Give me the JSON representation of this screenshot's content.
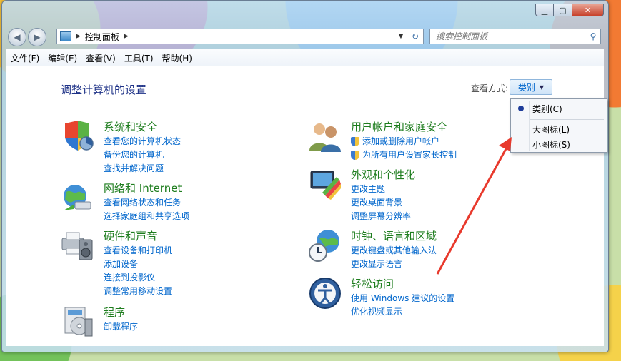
{
  "window": {
    "address_path": "控制面板",
    "search_placeholder": "搜索控制面板"
  },
  "menu": [
    "文件(F)",
    "编辑(E)",
    "查看(V)",
    "工具(T)",
    "帮助(H)"
  ],
  "main": {
    "title": "调整计算机的设置",
    "view_by_label": "查看方式:",
    "view_by_value": "类别"
  },
  "dropdown": {
    "items": [
      "类别(C)",
      "大图标(L)",
      "小图标(S)"
    ],
    "selected": "类别(C)"
  },
  "categories": [
    {
      "name": "系统和安全",
      "links": [
        "查看您的计算机状态",
        "备份您的计算机",
        "查找并解决问题"
      ]
    },
    {
      "name": "网络和 Internet",
      "links": [
        "查看网络状态和任务",
        "选择家庭组和共享选项"
      ]
    },
    {
      "name": "硬件和声音",
      "links": [
        "查看设备和打印机",
        "添加设备",
        "连接到投影仪",
        "调整常用移动设置"
      ]
    },
    {
      "name": "程序",
      "links": [
        "卸载程序"
      ]
    },
    {
      "name": "用户帐户和家庭安全",
      "links": [
        "添加或删除用户帐户",
        "为所有用户设置家长控制"
      ]
    },
    {
      "name": "外观和个性化",
      "links": [
        "更改主题",
        "更改桌面背景",
        "调整屏幕分辨率"
      ]
    },
    {
      "name": "时钟、语言和区域",
      "links": [
        "更改键盘或其他输入法",
        "更改显示语言"
      ]
    },
    {
      "name": "轻松访问",
      "links": [
        "使用 Windows 建议的设置",
        "优化视频显示"
      ]
    }
  ],
  "colors": {
    "heading_green": "#1e7d1e",
    "link_blue": "#0066cc",
    "title_blue": "#1e3287",
    "annotation_red": "#e8392c"
  }
}
